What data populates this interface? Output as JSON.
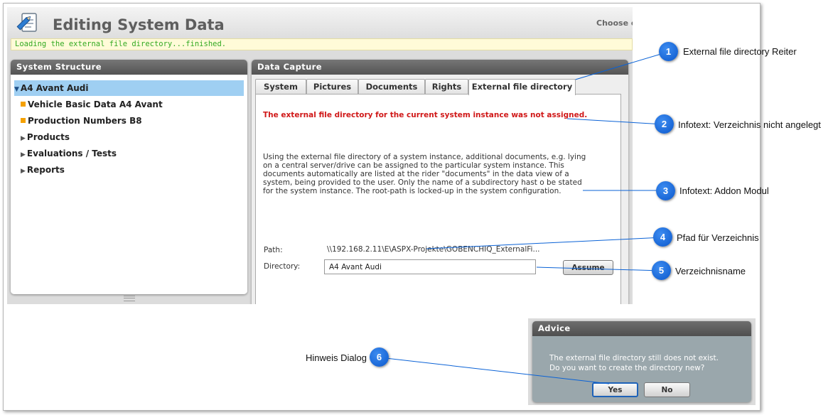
{
  "app": {
    "title": "Editing System Data",
    "choose_label": "Choose o",
    "status_message": "Loading the external file directory...finished."
  },
  "structure": {
    "title": "System Structure",
    "items": [
      {
        "label": "A4 Avant Audi",
        "icon": "triangle-down",
        "selected": true
      },
      {
        "label": "Vehicle Basic Data A4 Avant",
        "icon": "orange-square"
      },
      {
        "label": "Production Numbers B8",
        "icon": "orange-square"
      },
      {
        "label": "Products",
        "icon": "triangle-right"
      },
      {
        "label": "Evaluations / Tests",
        "icon": "triangle-right"
      },
      {
        "label": "Reports",
        "icon": "triangle-right"
      }
    ]
  },
  "capture": {
    "title": "Data Capture",
    "tabs": [
      "System",
      "Pictures",
      "Documents",
      "Rights",
      "External file directory"
    ],
    "active_tab": "External file directory",
    "warning": "The external file directory for the current system instance was not assigned.",
    "info_lines": [
      "Using the external file directory of a system instance, additional documents, e.g. lying",
      "on a central server/drive can be assigned to the particular system instance. This",
      "documents automatically are listed at the rider \"documents\" in the data view of a",
      "system, being provided to the user. Only the name of a subdirectory hast o be stated",
      "for the system instance. The root-path is locked-up in the system configuration."
    ],
    "path_label": "Path:",
    "path_value": "\\\\192.168.2.11\\E\\ASPX-Projekte\\GOBENCHIQ_ExternalFi...",
    "directory_label": "Directory:",
    "directory_value": "A4 Avant Audi",
    "assume_label": "Assume"
  },
  "dialog": {
    "title": "Advice",
    "line1": "The external file directory still does not exist.",
    "line2": "Do you want to create the directory new?",
    "yes_label": "Yes",
    "no_label": "No"
  },
  "callouts": [
    {
      "num": "1",
      "text": "External file directory Reiter"
    },
    {
      "num": "2",
      "text": "Infotext: Verzeichnis nicht angelegt"
    },
    {
      "num": "3",
      "text": "Infotext: Addon Modul"
    },
    {
      "num": "4",
      "text": "Pfad für Verzeichnis"
    },
    {
      "num": "5",
      "text": "Verzeichnisname"
    },
    {
      "num": "6",
      "text": "Hinweis Dialog"
    }
  ],
  "colors": {
    "callout_blue": "#0a62d6",
    "selection": "#9fcff2",
    "warning_red": "#d01818",
    "status_green": "#33aa22",
    "tree_square": "#f5a100"
  }
}
